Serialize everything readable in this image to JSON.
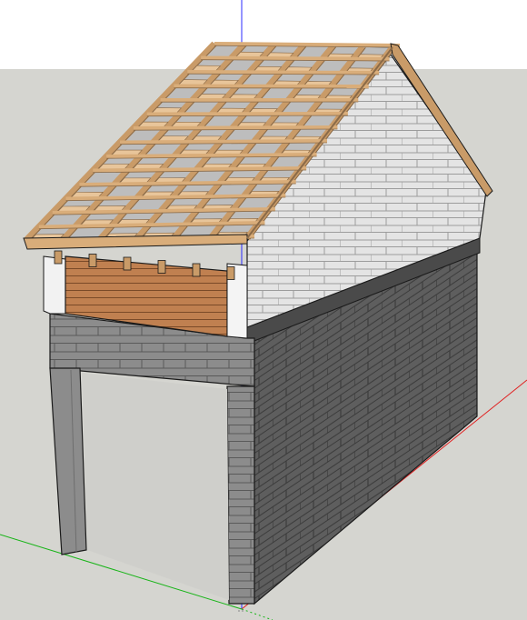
{
  "viewport": {
    "label": "",
    "sky_color": "#ffffff",
    "ground_color": "#d5d5d0",
    "axes": {
      "blue_color": "#2b2bff",
      "red_color": "#e02020",
      "green_color": "#18b418"
    }
  },
  "model": {
    "name": "",
    "colors": {
      "gable_brick": "#e4e4e4",
      "gable_mortar": "#9c9c9c",
      "wall_dark": "#5e5e5e",
      "wall_dark_mortar": "#3b3b3b",
      "front_gray": "#8c8c8c",
      "roof_rafter": "#c99b68",
      "roof_batten": "#d9ad7a",
      "roof_plank": "#e8c59a",
      "roof_shadow": "#8a6a48",
      "inner_wall": "#c08050",
      "edge": "#1a1a1a"
    }
  }
}
